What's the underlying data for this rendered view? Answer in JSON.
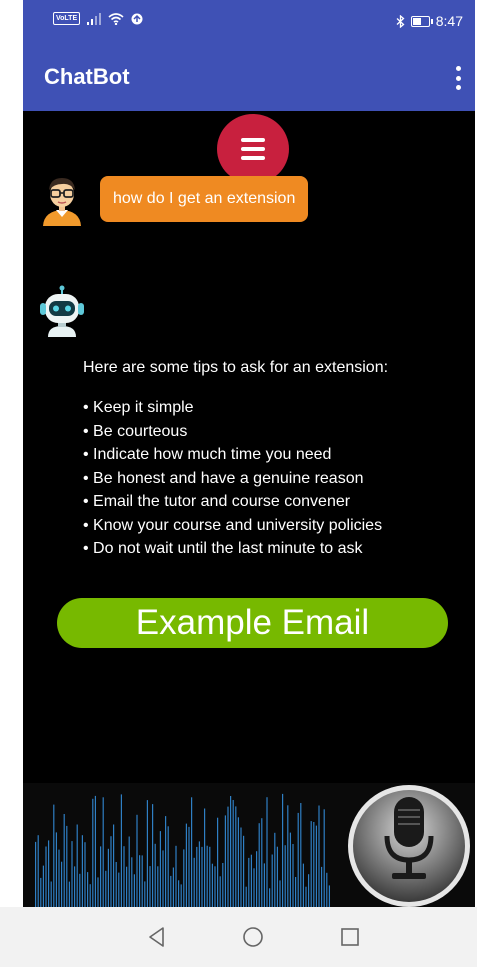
{
  "status_bar": {
    "left_badge": "VoLTE",
    "time": "8:47",
    "battery_level": 0.62,
    "background_color": "#3f51b5"
  },
  "app_bar": {
    "title": "ChatBot",
    "menu_icon": "more-vert-icon",
    "background_color": "#3f51b5"
  },
  "chat": {
    "menu_fab_icon": "hamburger-menu-icon",
    "menu_fab_color": "#c8203e",
    "messages": [
      {
        "sender": "user",
        "avatar": "user-avatar-icon",
        "text": "how do I get an extension",
        "bubble_color": "#ef8a22"
      },
      {
        "sender": "bot",
        "avatar": "robot-avatar-icon",
        "intro": "Here are some tips to ask for an extension:",
        "tips": [
          "Keep it simple",
          "Be courteous",
          "Indicate how much time you need",
          "Be honest and have a genuine reason",
          "Email the tutor and course convener",
          "Know your course and university policies",
          "Do not wait until the last minute to ask"
        ]
      }
    ],
    "example_button": {
      "label": "Example Email",
      "color": "#77b900"
    }
  },
  "voice": {
    "waveform_icon": "audio-waveform-icon",
    "waveform_color": "#2f7fc4",
    "mic_icon": "microphone-icon"
  },
  "nav_bar": {
    "back_icon": "back-triangle-icon",
    "home_icon": "home-circle-icon",
    "recents_icon": "recents-square-icon"
  }
}
